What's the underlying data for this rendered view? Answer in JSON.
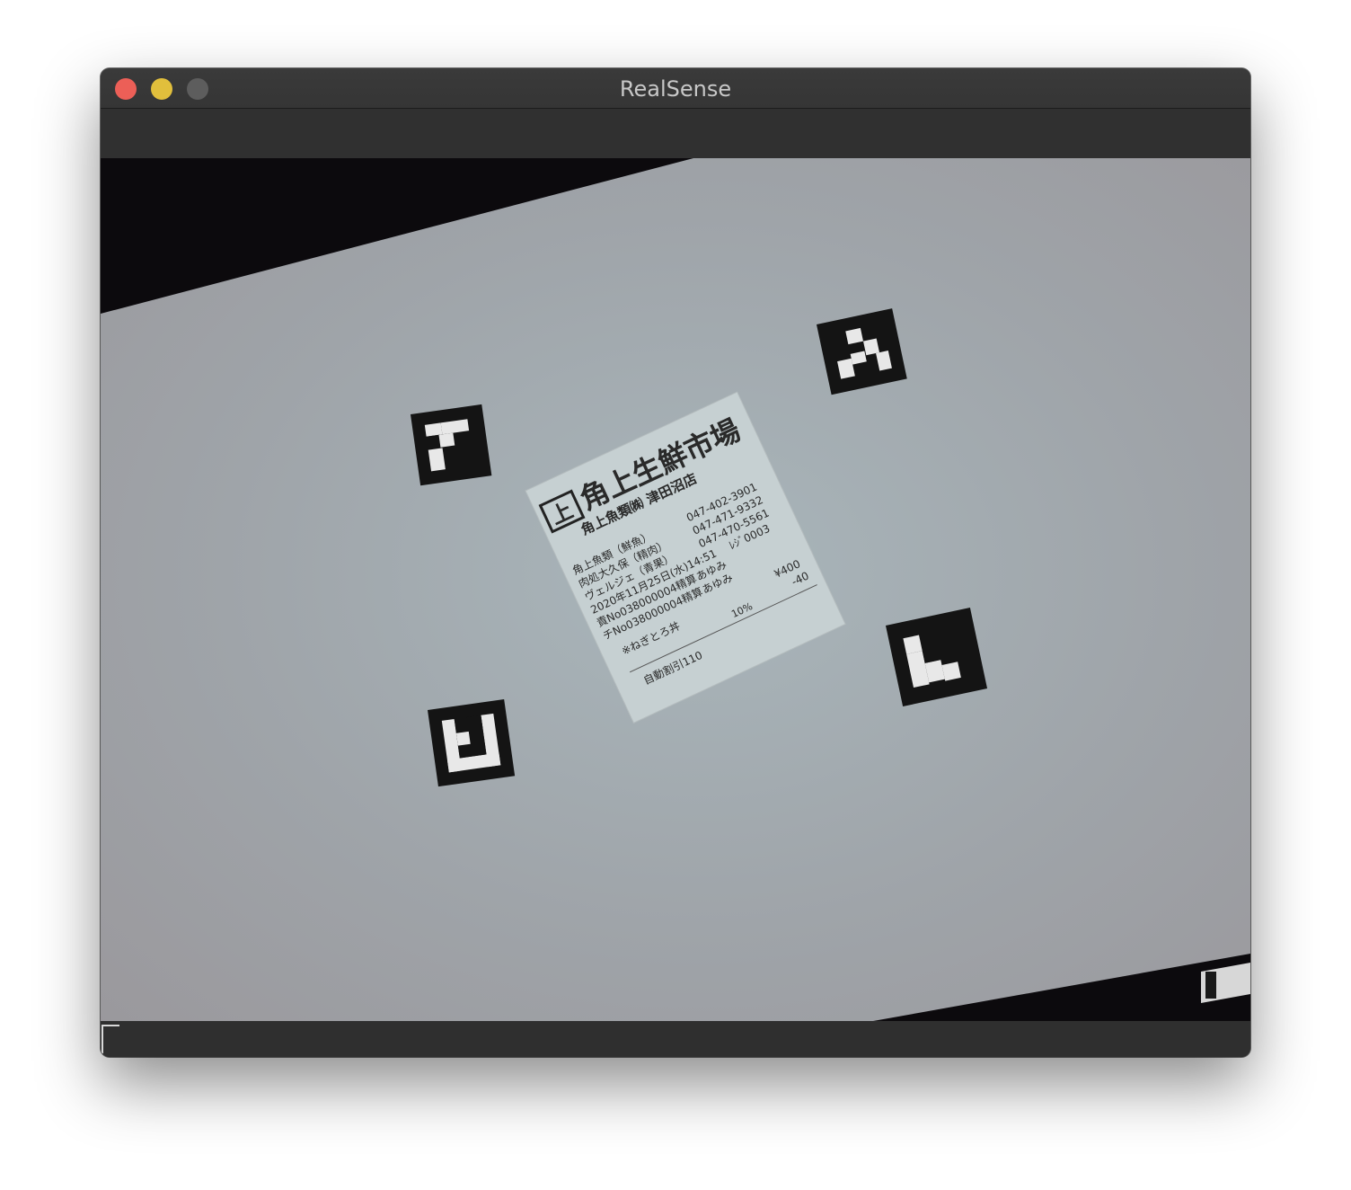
{
  "window": {
    "title": "RealSense"
  },
  "receipt": {
    "shop_name": "角上生鮮市場",
    "logo_mark": "上",
    "subtitle": "角上魚類㈱ 津田沼店",
    "phone_1": "047-402-3901",
    "phone_2": "047-471-9332",
    "phone_3": "047-470-5561",
    "register": "ﾚｼﾞ0003",
    "line_1": "角上魚類（鮮魚）",
    "line_2": "肉処大久保（精肉）",
    "line_3": "ヴェルジェ（青果）",
    "date_time": "2020年11月25日(水)14:51",
    "clerk_1": "あゆみ",
    "slip_1": "責No038000004精算",
    "clerk_2": "あゆみ",
    "slip_2": "チNo038000004精算",
    "item": "※ねぎとろ丼",
    "price_1": "¥400",
    "price_2": "-40",
    "tax": "10%",
    "footer": "自動割引110"
  }
}
